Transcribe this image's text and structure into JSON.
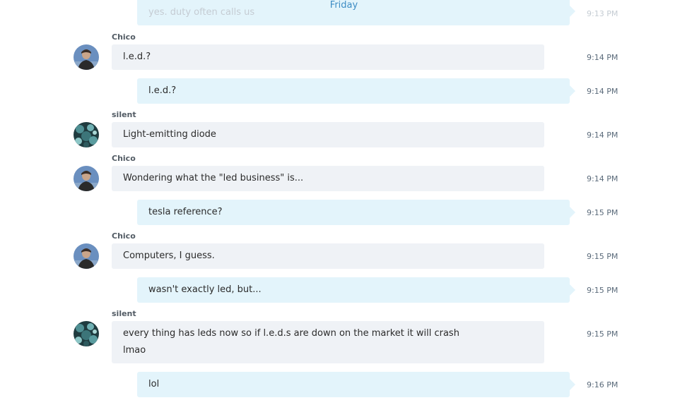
{
  "header": {
    "day": "Friday"
  },
  "messages": [
    {
      "from": "me",
      "text": "yes. duty often calls us",
      "time": "9:13 PM"
    },
    {
      "from": "Chico",
      "text": "l.e.d.?",
      "time": "9:14 PM"
    },
    {
      "from": "me",
      "text": "l.e.d.?",
      "time": "9:14 PM"
    },
    {
      "from": "silent",
      "text": "Light-emitting diode",
      "time": "9:14 PM"
    },
    {
      "from": "Chico",
      "text": "Wondering what the \"led business\" is...",
      "time": "9:14 PM"
    },
    {
      "from": "me",
      "text": "tesla reference?",
      "time": "9:15 PM"
    },
    {
      "from": "Chico",
      "text": "Computers, I guess.",
      "time": "9:15 PM"
    },
    {
      "from": "me",
      "text": "wasn't exactly led, but...",
      "time": "9:15 PM"
    },
    {
      "from": "silent",
      "lines": [
        "every thing has leds now so if l.e.d.s are down on the market it will crash",
        "lmao"
      ],
      "time": "9:15 PM"
    },
    {
      "from": "me",
      "text": "lol",
      "time": "9:16 PM"
    }
  ],
  "colors": {
    "incoming_bubble": "#eff2f6",
    "outgoing_bubble": "#e3f4fb",
    "day_label": "#3d8cc4",
    "sender_name": "#525b64"
  },
  "icons": {
    "chico_avatar": "person-avatar",
    "silent_avatar": "teal-pattern-avatar"
  }
}
